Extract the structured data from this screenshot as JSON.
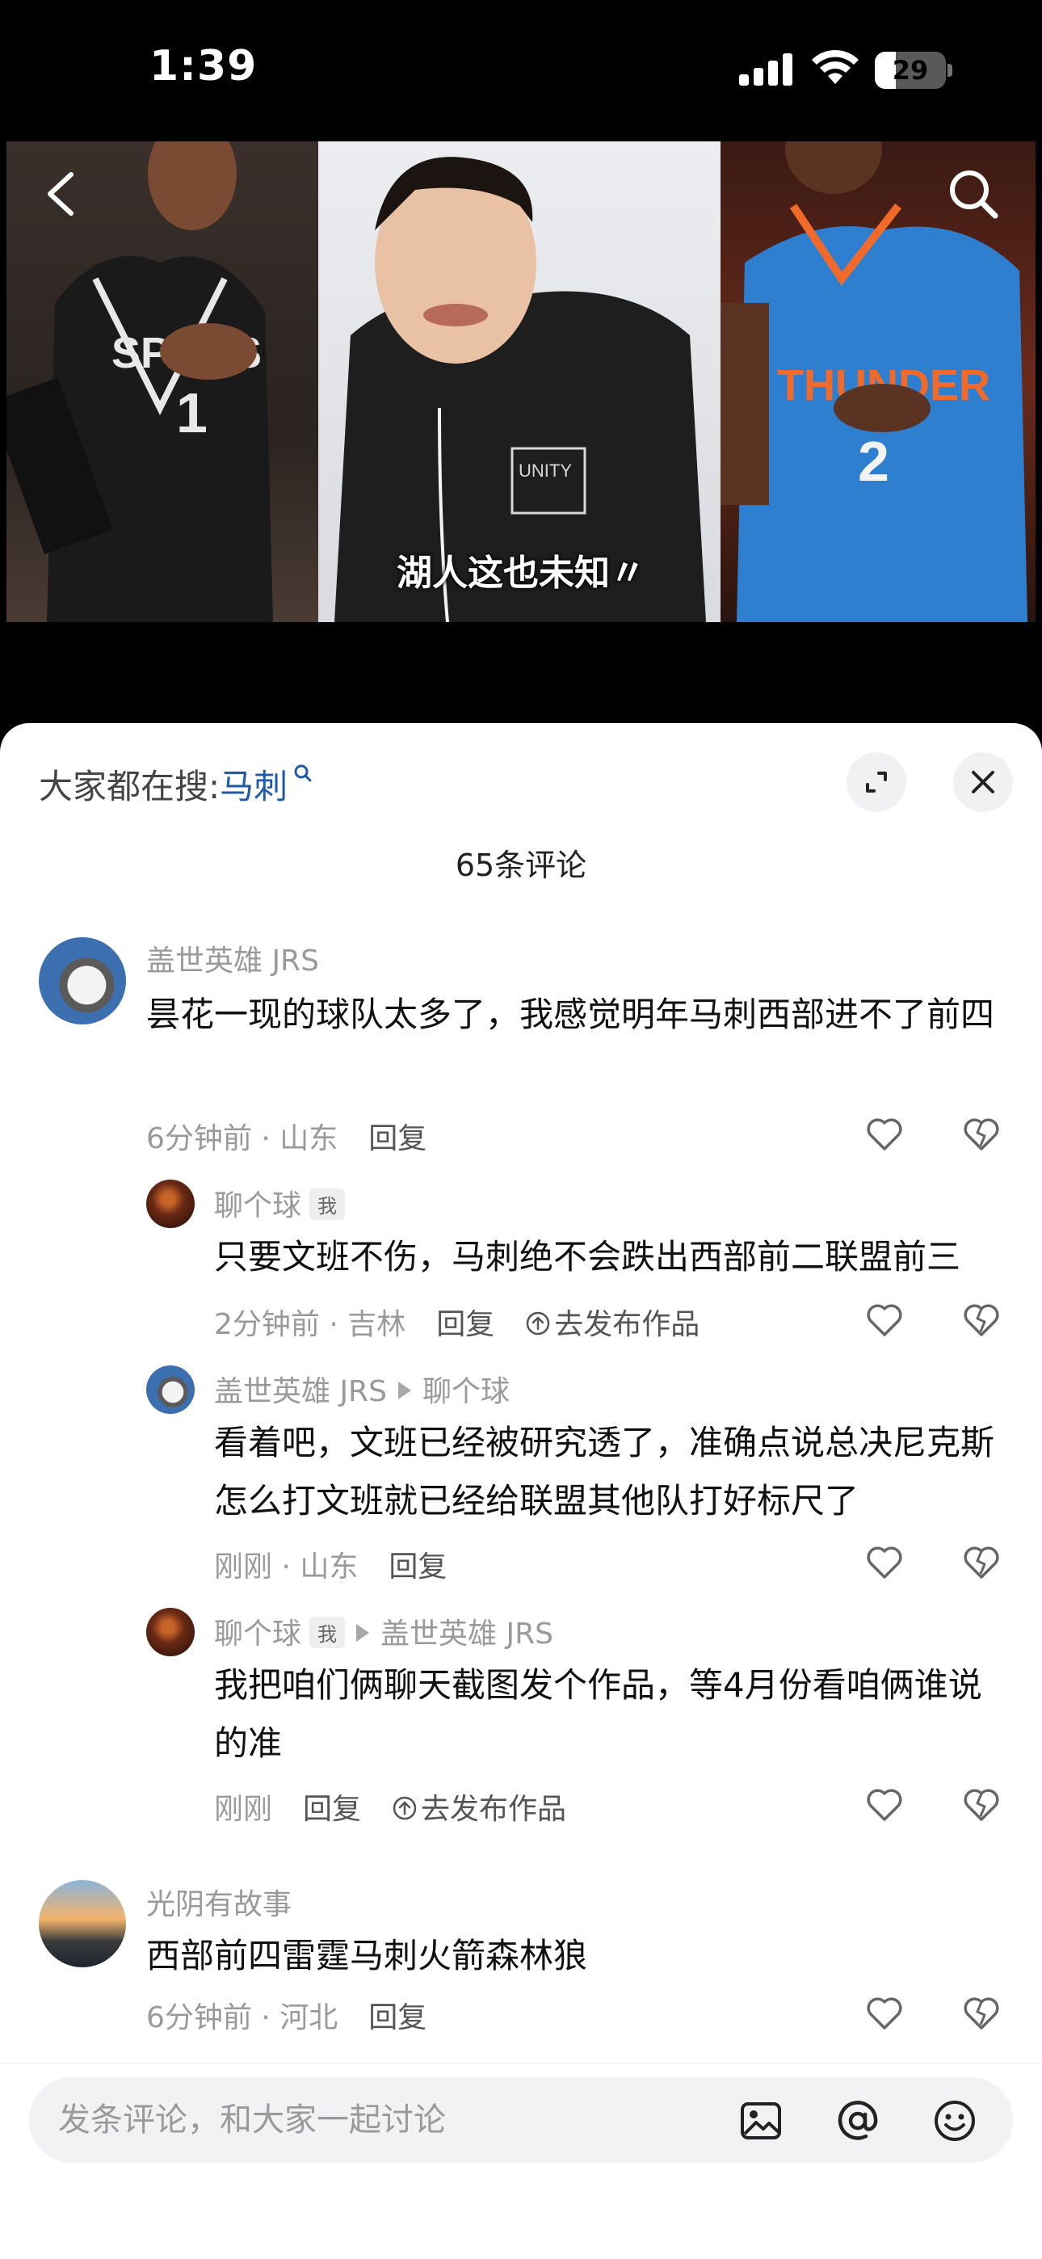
{
  "status": {
    "time": "1:39",
    "battery": "29",
    "battery_level": 0.29
  },
  "video": {
    "subtitle": "湖人这也未知〃"
  },
  "header": {
    "hot_search_prefix": "大家都在搜:",
    "hot_search_keyword": "马刺",
    "comment_count": "65条评论"
  },
  "comments": [
    {
      "user": "盖世英雄 JRS",
      "text": "昙花一现的球队太多了，我感觉明年马刺西部进不了前四",
      "time": "6分钟前 · 山东",
      "reply": "回复"
    },
    {
      "user": "聊个球",
      "tag": "我",
      "text": "只要文班不伤，马刺绝不会跌出西部前二联盟前三",
      "time": "2分钟前 · 吉林",
      "reply": "回复",
      "publish": "去发布作品"
    },
    {
      "user": "盖世英雄 JRS",
      "reply_to": "聊个球",
      "text": "看着吧，文班已经被研究透了，准确点说总决尼克斯怎么打文班就已经给联盟其他队打好标尺了",
      "time": "刚刚 · 山东",
      "reply": "回复"
    },
    {
      "user": "聊个球",
      "tag": "我",
      "reply_to": "盖世英雄 JRS",
      "text": "我把咱们俩聊天截图发个作品，等4月份看咱俩谁说的准",
      "time": "刚刚",
      "reply": "回复",
      "publish": "去发布作品"
    },
    {
      "user": "光阴有故事",
      "text": "西部前四雷霆马刺火箭森林狼",
      "time": "6分钟前 · 河北",
      "reply": "回复"
    }
  ],
  "input": {
    "placeholder": "发条评论，和大家一起讨论"
  },
  "icons": [
    "back-icon",
    "search-icon",
    "expand-icon",
    "close-icon",
    "heart-icon",
    "broken-heart-icon",
    "image-icon",
    "at-icon",
    "emoji-icon",
    "publish-icon"
  ]
}
